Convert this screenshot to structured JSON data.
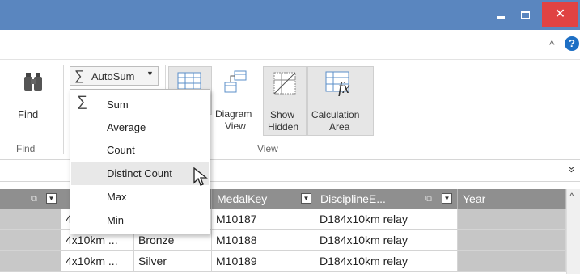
{
  "window": {
    "minimize_glyph": "",
    "maximize_glyph": "",
    "close_glyph": "✕"
  },
  "ribbon": {
    "find": {
      "label": "Find",
      "group_label": "Find"
    },
    "autosum": {
      "label": "AutoSum"
    },
    "view": {
      "diagram_view": [
        "Diagram",
        "View"
      ],
      "show_hidden": [
        "Show",
        "Hidden"
      ],
      "calculation_area": [
        "Calculation",
        "Area"
      ],
      "group_label": "View"
    },
    "collapse_glyph": "^",
    "help_glyph": "?"
  },
  "autosum_menu": {
    "items": [
      "Sum",
      "Average",
      "Count",
      "Distinct Count",
      "Max",
      "Min"
    ],
    "hovered": "Distinct Count"
  },
  "formula_bar": {
    "expand_glyph": "»"
  },
  "grid": {
    "columns": [
      {
        "label": ""
      },
      {
        "label": ""
      },
      {
        "label": ""
      },
      {
        "label": "MedalKey"
      },
      {
        "label": "DisciplineE..."
      },
      {
        "label": "Year"
      }
    ],
    "rows": [
      [
        "",
        "4",
        "",
        "M10187",
        "D184x10km relay",
        ""
      ],
      [
        "",
        "4x10km ...",
        "Bronze",
        "M10188",
        "D184x10km relay",
        ""
      ],
      [
        "",
        "4x10km ...",
        "Silver",
        "M10189",
        "D184x10km relay",
        ""
      ]
    ]
  },
  "colors": {
    "titlebar": "#5a86bf",
    "close_button": "#e04343",
    "grid_header": "#8f8f8f",
    "selected_row": "#c8c8c8",
    "help_icon": "#1e6fc4"
  }
}
